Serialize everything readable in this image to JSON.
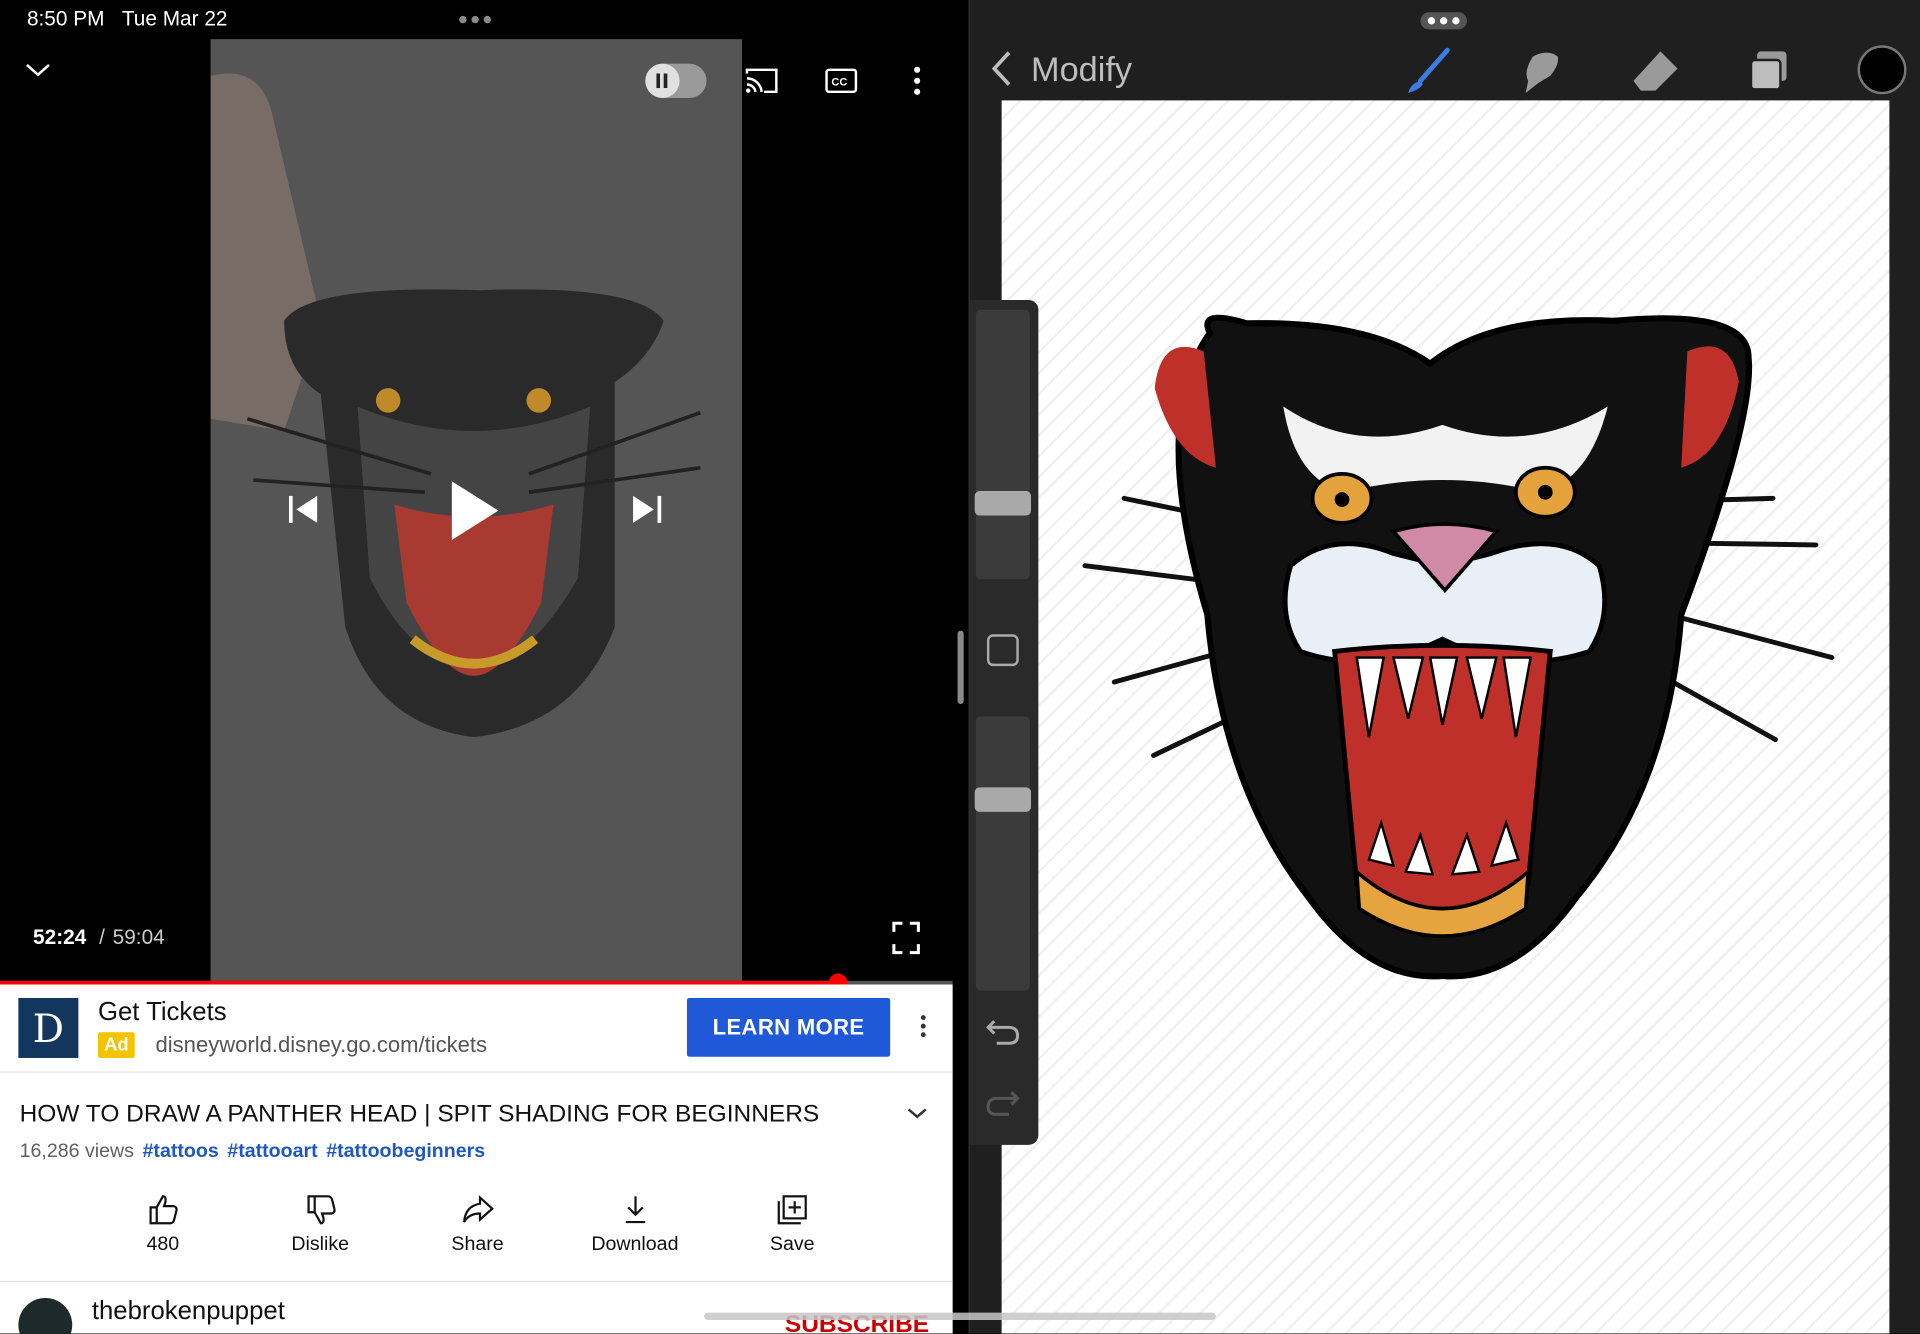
{
  "status_bar": {
    "time": "8:50 PM",
    "date": "Tue Mar 22"
  },
  "player": {
    "current_time": "52:24",
    "separator": "/",
    "total_time": "59:04",
    "progress": 0.879,
    "autoplay": "paused"
  },
  "ad": {
    "title": "Get Tickets",
    "badge": "Ad",
    "url": "disneyworld.disney.go.com/tickets",
    "cta": "LEARN MORE"
  },
  "video": {
    "title": "HOW TO DRAW A PANTHER HEAD | SPIT SHADING FOR BEGINNERS",
    "views": "16,286 views",
    "tags": [
      "#tattoos",
      "#tattooart",
      "#tattoobeginners"
    ]
  },
  "actions": [
    {
      "label": "480",
      "icon": "thumbs-up-icon"
    },
    {
      "label": "Dislike",
      "icon": "thumbs-down-icon"
    },
    {
      "label": "Share",
      "icon": "share-icon"
    },
    {
      "label": "Download",
      "icon": "download-icon"
    },
    {
      "label": "Save",
      "icon": "save-to-playlist-icon"
    }
  ],
  "channel": {
    "name": "thebrokenpuppet",
    "subscribe": "SUBSCRIBE"
  },
  "procreate": {
    "back_label": "Modify",
    "tools": [
      "brush-icon",
      "smudge-icon",
      "eraser-icon",
      "layers-icon"
    ],
    "current_color": "#000000"
  },
  "colors": {
    "accent_blue": "#2059d8",
    "progress_red": "#ff0000",
    "ad_yellow": "#f4c400",
    "subscribe_red": "#cc0000"
  }
}
